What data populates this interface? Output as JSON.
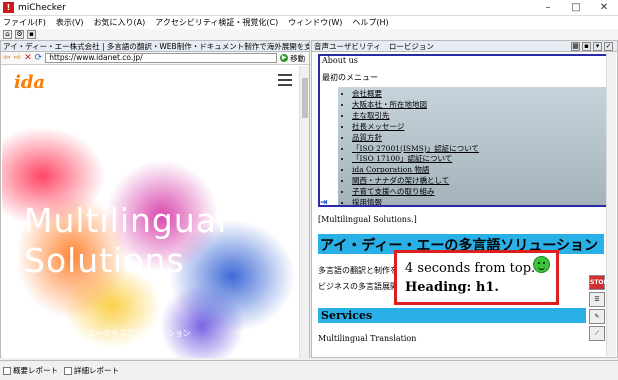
{
  "window": {
    "title": "miChecker"
  },
  "menu": [
    "ファイル(F)",
    "表示(V)",
    "お気に入り(A)",
    "アクセシビリティ検証・視覚化(C)",
    "ウィンドウ(W)",
    "ヘルプ(H)"
  ],
  "left": {
    "tab": "アイ・ディー・エー株式会社 | 多言語の翻訳・WEB制作・ドキュメント制作で海外展開を支援",
    "url": "https://www.idanet.co.jp/",
    "go_label": "移動",
    "logo": "ida",
    "hero_title": "Multilingual Solutions",
    "hero_sub": "アイ・ディー・エーの多言語ソリューション"
  },
  "right": {
    "tabs": [
      "音声ユーザビリティ",
      "ロービジョン"
    ],
    "about": "About us",
    "first_menu": "最初のメニュー",
    "menu_items": [
      "会社概要",
      "大阪本社・所在地地図",
      "主な取引先",
      "社長メッセージ",
      "品質方針",
      "「ISO 27001(ISMS)」認証について",
      "「ISO 17100」認証について",
      "ida Corporation 物語",
      "関西・ナナダの架け橋として",
      "子育て支援への取り組み",
      "採用情報"
    ],
    "multilingual_bracket": "[Multilingual Solutions.]",
    "heading": "アイ・ディー・エーの多言語ソリューション",
    "para1": "多言語の翻訳と制作を",
    "para2": "ビジネスの多言語展開",
    "services": "Services",
    "multilingual_translation": "Multilingual Translation"
  },
  "popup": {
    "line1": "4 seconds from top.",
    "line2": "Heading: h1."
  },
  "bottom": {
    "tab1": "概要レポート",
    "tab2": "詳細レポート"
  },
  "colors": {
    "heading_bg": "#29b0e6",
    "popup_border": "#dc1e1e",
    "frame": "#2a2aa8"
  }
}
